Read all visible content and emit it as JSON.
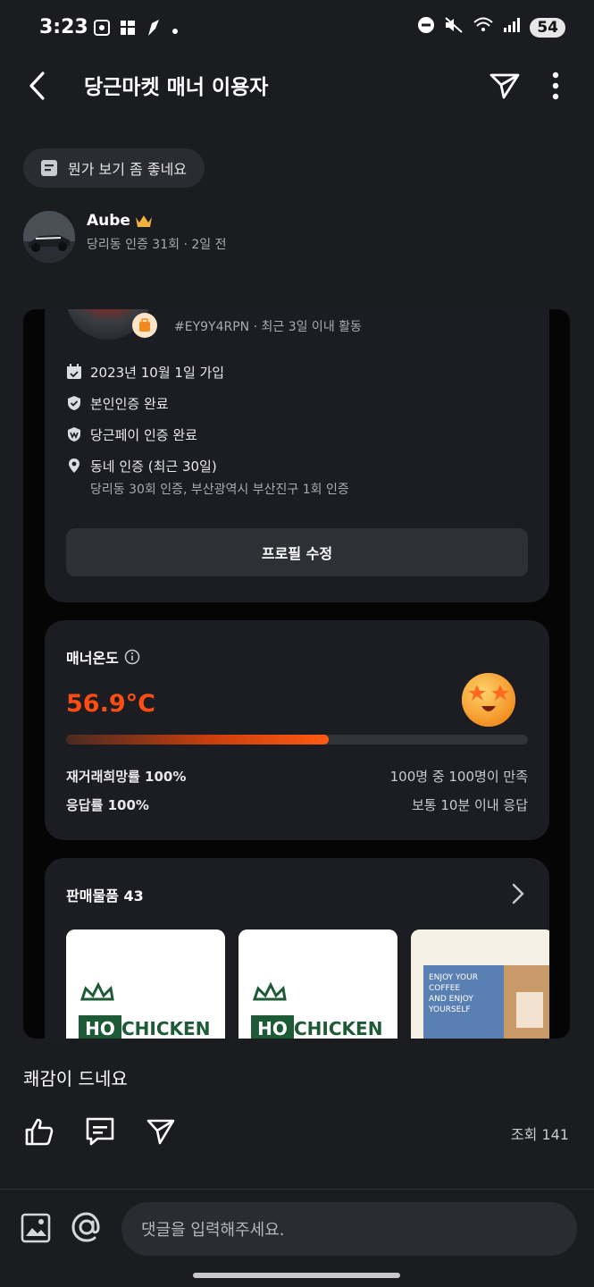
{
  "status_bar": {
    "time": "3:23",
    "battery": "54"
  },
  "header": {
    "title": "당근마켓 매너 이용자"
  },
  "chip": {
    "label": "뭔가 보기 좀 좋네요"
  },
  "author": {
    "name": "Aube",
    "meta": "당리동 인증 31회 · 2일 전"
  },
  "screenshot": {
    "profile_code": "#EY9Y4RPN · 최근 3일 이내 활동",
    "info": [
      {
        "icon": "calendar-icon",
        "text": "2023년 10월 1일 가입"
      },
      {
        "icon": "shield-check-icon",
        "text": "본인인증 완료"
      },
      {
        "icon": "pay-shield-icon",
        "text": "당근페이 인증 완료"
      },
      {
        "icon": "location-pin-icon",
        "text": "동네 인증 (최근 30일)",
        "sub": "당리동 30회 인증, 부산광역시 부산진구 1회 인증"
      }
    ],
    "edit_button": "프로필 수정",
    "manner": {
      "title": "매너온도",
      "temperature": "56.9°C",
      "progress": 0.569,
      "rows": [
        {
          "label": "재거래희망률 100%",
          "value": "100명 중 100명이 만족"
        },
        {
          "label": "응답률 100%",
          "value": "보통 10분 이내 응답"
        }
      ]
    },
    "sales": {
      "title": "판매물품 43",
      "products": [
        {
          "brand": "HOCHICKEN"
        },
        {
          "brand": "HOCHICKEN"
        },
        {
          "text": "ENJOY YOUR COFFEE AND ENJOY YOURSELF"
        }
      ]
    }
  },
  "post": {
    "caption": "쾌감이 드네요",
    "views": "조회 141"
  },
  "comment": {
    "placeholder": "댓글을 입력해주세요."
  },
  "colors": {
    "background": "#1b1c20",
    "accent": "#ff5a12",
    "temperature_text": "#ff4d12"
  }
}
